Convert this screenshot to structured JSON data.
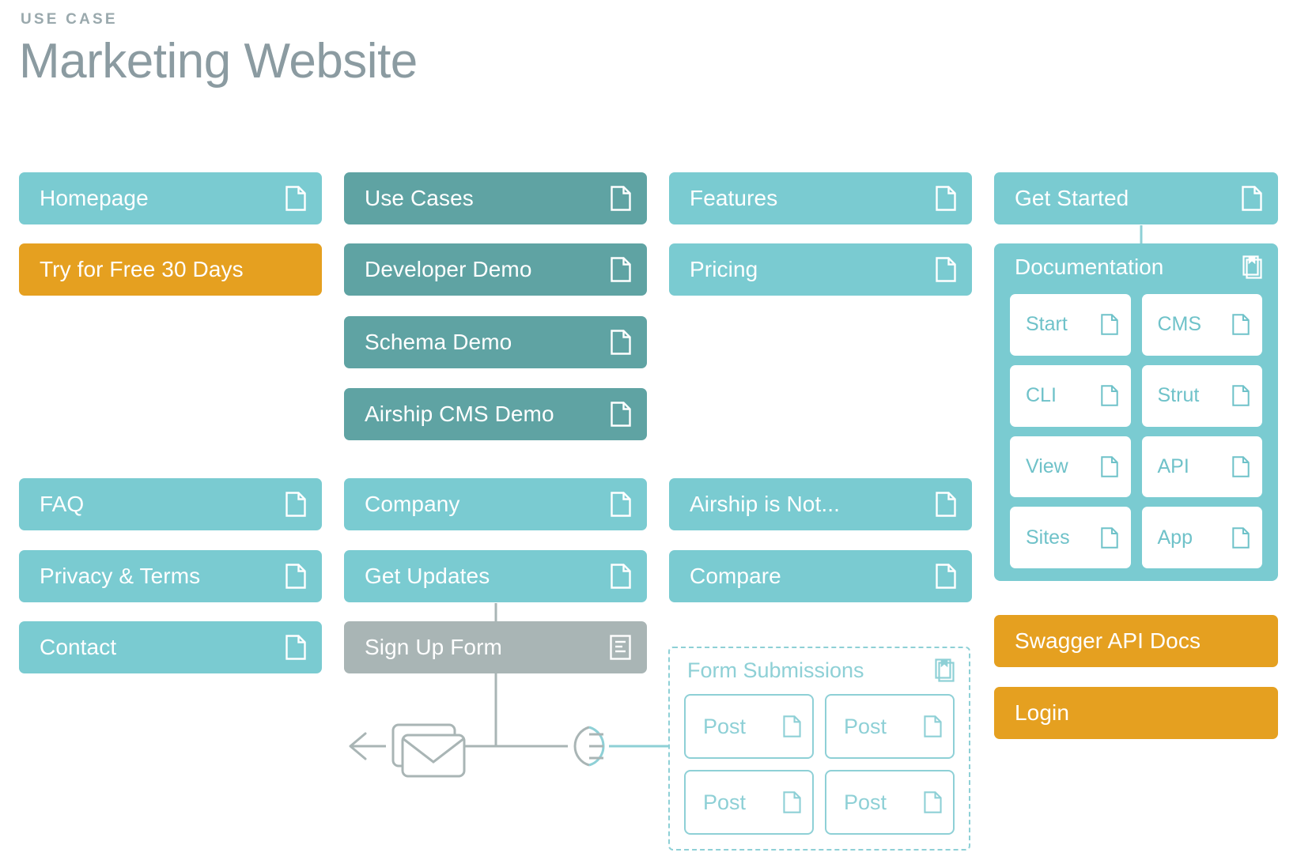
{
  "header": {
    "eyebrow": "USE CASE",
    "title": "Marketing Website"
  },
  "colors": {
    "teal": "#7acbd1",
    "dark_teal": "#5fa3a3",
    "orange": "#e5a020",
    "gray": "#a9b5b5",
    "outline_teal": "#8ed0d6",
    "title_gray": "#8b9ba1",
    "eyebrow_gray": "#9aa9ad",
    "wire_gray": "#a9b5b5"
  },
  "columns": {
    "col1": {
      "top": [
        {
          "label": "Homepage",
          "style": "teal",
          "icon": "page-icon"
        },
        {
          "label": "Try for Free 30 Days",
          "style": "orange",
          "icon": "none"
        }
      ],
      "bottom": [
        {
          "label": "FAQ",
          "style": "teal",
          "icon": "page-icon"
        },
        {
          "label": "Privacy & Terms",
          "style": "teal",
          "icon": "page-icon"
        },
        {
          "label": "Contact",
          "style": "teal",
          "icon": "page-icon"
        }
      ]
    },
    "col2": {
      "top": [
        {
          "label": "Use Cases",
          "style": "dteal",
          "icon": "page-icon"
        },
        {
          "label": "Developer Demo",
          "style": "dteal",
          "icon": "page-icon"
        },
        {
          "label": "Schema Demo",
          "style": "dteal",
          "icon": "page-icon"
        },
        {
          "label": "Airship CMS Demo",
          "style": "dteal",
          "icon": "page-icon"
        }
      ],
      "bottom": [
        {
          "label": "Company",
          "style": "teal",
          "icon": "page-icon"
        },
        {
          "label": "Get Updates",
          "style": "teal",
          "icon": "page-icon"
        },
        {
          "label": "Sign Up Form",
          "style": "gray",
          "icon": "form-icon"
        }
      ]
    },
    "col3": {
      "top": [
        {
          "label": "Features",
          "style": "teal",
          "icon": "page-icon"
        },
        {
          "label": "Pricing",
          "style": "teal",
          "icon": "page-icon"
        }
      ],
      "bottom": [
        {
          "label": "Airship is Not...",
          "style": "teal",
          "icon": "page-icon"
        },
        {
          "label": "Compare",
          "style": "teal",
          "icon": "page-icon"
        }
      ]
    },
    "col4": {
      "top": [
        {
          "label": "Get Started",
          "style": "teal",
          "icon": "page-icon"
        }
      ],
      "bottom": [
        {
          "label": "Swagger API Docs",
          "style": "orange",
          "icon": "none"
        },
        {
          "label": "Login",
          "style": "orange",
          "icon": "none"
        }
      ]
    }
  },
  "documentation_group": {
    "title": "Documentation",
    "icon": "pages-stack-icon",
    "items": [
      {
        "label": "Start",
        "icon": "page-icon"
      },
      {
        "label": "CMS",
        "icon": "page-icon"
      },
      {
        "label": "CLI",
        "icon": "page-icon"
      },
      {
        "label": "Strut",
        "icon": "page-icon"
      },
      {
        "label": "View",
        "icon": "page-icon"
      },
      {
        "label": "API",
        "icon": "page-icon"
      },
      {
        "label": "Sites",
        "icon": "page-icon"
      },
      {
        "label": "App",
        "icon": "page-icon"
      }
    ]
  },
  "form_submissions_group": {
    "title": "Form Submissions",
    "icon": "pages-stack-icon",
    "items": [
      {
        "label": "Post",
        "icon": "page-icon"
      },
      {
        "label": "Post",
        "icon": "page-icon"
      },
      {
        "label": "Post",
        "icon": "page-icon"
      },
      {
        "label": "Post",
        "icon": "page-icon"
      }
    ]
  },
  "connectors": {
    "email_icon": "envelope-icon",
    "plug_icon": "plug-icon",
    "arrow_icon": "arrow-left-icon"
  }
}
